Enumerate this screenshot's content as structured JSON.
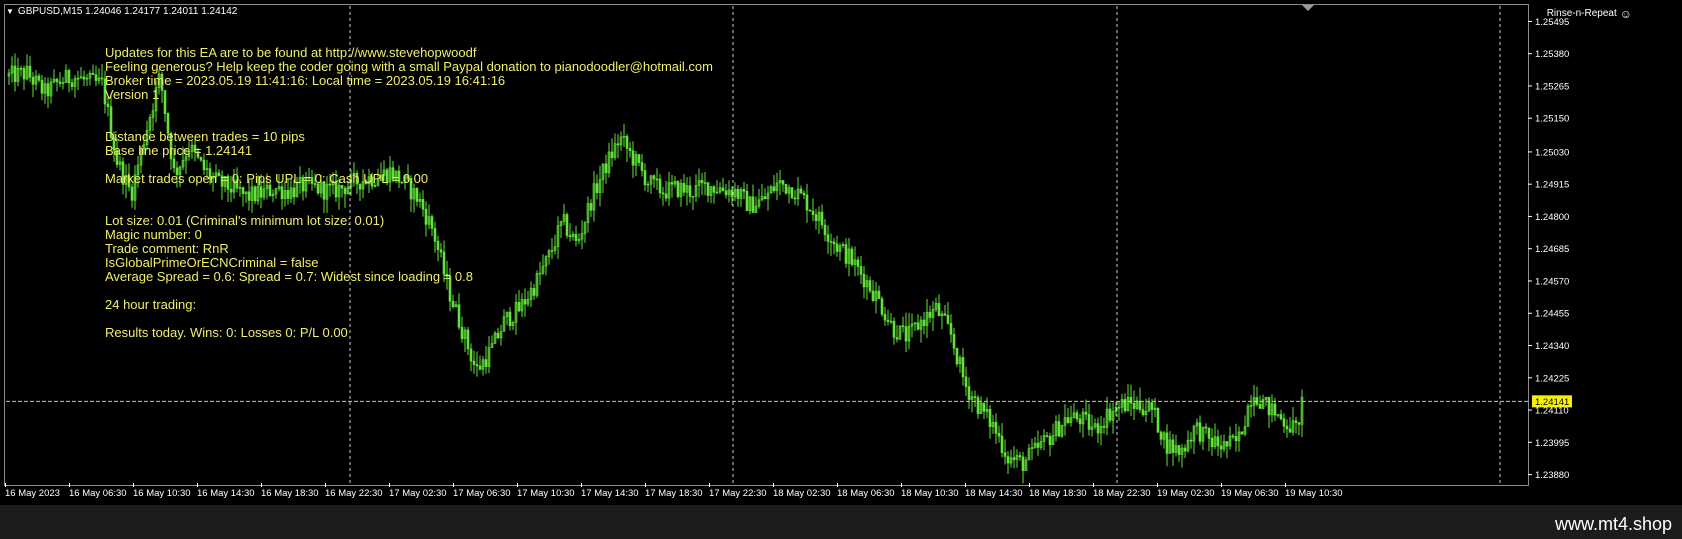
{
  "chart": {
    "symbol_line": "GBPUSD,M15  1.24046 1.24177 1.24011 1.24142",
    "ea_name": "Rinse-n-Repeat",
    "ea_icon": "smiley-icon",
    "current_price_label": "1.24141",
    "current_price": 1.24141,
    "colors": {
      "background": "#000000",
      "candles": "#62e23a",
      "overlay_text": "#f0ee6a",
      "axis": "#ffffff",
      "price_badge_bg": "#f6f200",
      "grid": "#ffffff"
    }
  },
  "overlay": {
    "lines": [
      "Updates for this EA are to be found at http://www.stevehopwoodf",
      "Feeling generous? Help keep the coder going with a small Paypal donation to pianodoodler@hotmail.com",
      "Broker time = 2023.05.19 11:41:16: Local time = 2023.05.19 16:41:16",
      "Version 1",
      "",
      "",
      "Distance between trades = 10 pips",
      "Base line price = 1.24141",
      "",
      "Market trades open = 0: Pips UPL = 0: Cash UPL = 0.00",
      "",
      "",
      "Lot size: 0.01 (Criminal's minimum lot size: 0.01)",
      "Magic number: 0",
      "Trade comment: RnR",
      "IsGlobalPrimeOrECNCriminal = false",
      "Average Spread = 0.6: Spread = 0.7: Widest since loading = 0.8",
      "",
      "24 hour trading:",
      "",
      "Results today. Wins: 0: Losses 0: P/L 0.00"
    ]
  },
  "chart_data": {
    "type": "candlestick",
    "symbol": "GBPUSD",
    "timeframe": "M15",
    "y_ticks": [
      "1.25495",
      "1.25380",
      "1.25265",
      "1.25150",
      "1.25030",
      "1.24915",
      "1.24800",
      "1.24685",
      "1.24570",
      "1.24455",
      "1.24340",
      "1.24225",
      "1.24110",
      "1.23995",
      "1.23880"
    ],
    "x_ticks": [
      "16 May 2023",
      "16 May 06:30",
      "16 May 10:30",
      "16 May 14:30",
      "16 May 18:30",
      "16 May 22:30",
      "17 May 02:30",
      "17 May 06:30",
      "17 May 10:30",
      "17 May 14:30",
      "17 May 18:30",
      "17 May 22:30",
      "18 May 02:30",
      "18 May 06:30",
      "18 May 10:30",
      "18 May 14:30",
      "18 May 18:30",
      "18 May 22:30",
      "19 May 02:30",
      "19 May 06:30",
      "19 May 10:30"
    ],
    "ylim": [
      1.2385,
      1.2555
    ],
    "grid": "vertical dashed separators",
    "close_path": [
      [
        0,
        1.253
      ],
      [
        5,
        1.2531
      ],
      [
        10,
        1.2524
      ],
      [
        14,
        1.2528
      ],
      [
        18,
        1.253
      ],
      [
        22,
        1.2528
      ],
      [
        26,
        1.2527
      ],
      [
        30,
        1.25
      ],
      [
        34,
        1.2488
      ],
      [
        38,
        1.251
      ],
      [
        42,
        1.253
      ],
      [
        46,
        1.2495
      ],
      [
        50,
        1.2505
      ],
      [
        54,
        1.2497
      ],
      [
        58,
        1.2492
      ],
      [
        62,
        1.249
      ],
      [
        66,
        1.2487
      ],
      [
        70,
        1.2488
      ],
      [
        74,
        1.249
      ],
      [
        78,
        1.2489
      ],
      [
        82,
        1.2491
      ],
      [
        86,
        1.249
      ],
      [
        90,
        1.2489
      ],
      [
        94,
        1.2491
      ],
      [
        98,
        1.2493
      ],
      [
        102,
        1.2494
      ],
      [
        106,
        1.2496
      ],
      [
        110,
        1.2492
      ],
      [
        114,
        1.2486
      ],
      [
        118,
        1.2475
      ],
      [
        122,
        1.2455
      ],
      [
        126,
        1.244
      ],
      [
        130,
        1.2425
      ],
      [
        134,
        1.2432
      ],
      [
        138,
        1.2443
      ],
      [
        142,
        1.2447
      ],
      [
        146,
        1.2455
      ],
      [
        150,
        1.2465
      ],
      [
        154,
        1.2478
      ],
      [
        158,
        1.247
      ],
      [
        162,
        1.2486
      ],
      [
        166,
        1.2498
      ],
      [
        170,
        1.2508
      ],
      [
        174,
        1.25
      ],
      [
        178,
        1.2492
      ],
      [
        182,
        1.2489
      ],
      [
        186,
        1.249
      ],
      [
        190,
        1.2489
      ],
      [
        194,
        1.2491
      ],
      [
        198,
        1.249
      ],
      [
        202,
        1.2489
      ],
      [
        206,
        1.2484
      ],
      [
        210,
        1.2486
      ],
      [
        214,
        1.2492
      ],
      [
        218,
        1.249
      ],
      [
        222,
        1.2485
      ],
      [
        226,
        1.2478
      ],
      [
        230,
        1.247
      ],
      [
        234,
        1.2465
      ],
      [
        238,
        1.2458
      ],
      [
        242,
        1.245
      ],
      [
        246,
        1.244
      ],
      [
        250,
        1.2437
      ],
      [
        254,
        1.2443
      ],
      [
        258,
        1.2447
      ],
      [
        262,
        1.2438
      ],
      [
        266,
        1.242
      ],
      [
        270,
        1.2412
      ],
      [
        274,
        1.2405
      ],
      [
        278,
        1.2394
      ],
      [
        282,
        1.2392
      ],
      [
        286,
        1.2397
      ],
      [
        290,
        1.2402
      ],
      [
        294,
        1.2408
      ],
      [
        298,
        1.2408
      ],
      [
        302,
        1.2404
      ],
      [
        306,
        1.241
      ],
      [
        310,
        1.2413
      ],
      [
        314,
        1.2413
      ],
      [
        318,
        1.2411
      ],
      [
        322,
        1.2399
      ],
      [
        326,
        1.2396
      ],
      [
        330,
        1.2405
      ],
      [
        334,
        1.24
      ],
      [
        338,
        1.2398
      ],
      [
        342,
        1.24
      ],
      [
        346,
        1.2418
      ],
      [
        350,
        1.2412
      ],
      [
        354,
        1.2408
      ],
      [
        358,
        1.2404
      ],
      [
        360,
        1.2414
      ]
    ]
  },
  "footer": {
    "watermark": "www.mt4.shop"
  }
}
